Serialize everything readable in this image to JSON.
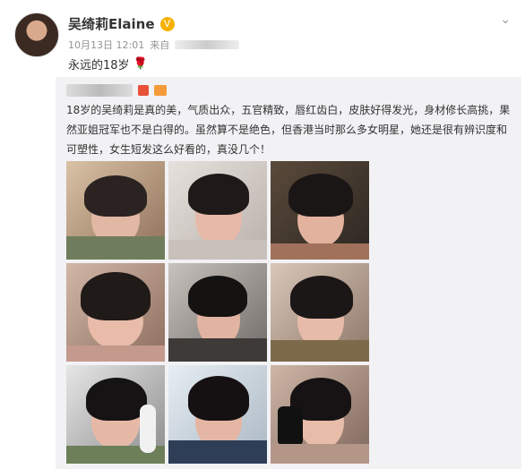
{
  "user": {
    "name": "吴绮莉Elaine",
    "verified": "V"
  },
  "meta": {
    "time": "10月13日 12:01",
    "source_prefix": "来自"
  },
  "post": {
    "text": "永远的18岁",
    "emoji": "🌹"
  },
  "repost": {
    "text": "18岁的吴绮莉是真的美，气质出众，五官精致，唇红齿白，皮肤好得发光，身材修长高挑，果然亚姐冠军也不是白得的。虽然算不是绝色，但香港当时那么多女明星，她还是很有辨识度和可塑性，女生短发这么好看的，真没几个！",
    "image_count": 9
  },
  "colors": {
    "accent": "#f6b100",
    "repost_bg": "#f2f2f5",
    "meta": "#939393"
  },
  "icons": {
    "verified": "verified-badge-icon",
    "chevron": "chevron-down-icon",
    "rose": "rose-icon"
  }
}
